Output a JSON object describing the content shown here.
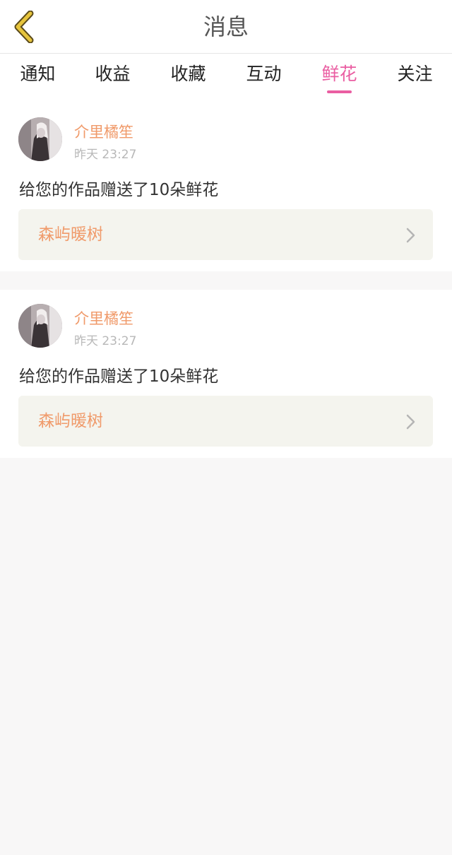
{
  "header": {
    "title": "消息",
    "back_icon": "chevron-left-icon",
    "back_icon_color": "#e6c43c"
  },
  "tabs": [
    {
      "label": "通知",
      "active": false
    },
    {
      "label": "收益",
      "active": false
    },
    {
      "label": "收藏",
      "active": false
    },
    {
      "label": "互动",
      "active": false
    },
    {
      "label": "鲜花",
      "active": true
    },
    {
      "label": "关注",
      "active": false
    }
  ],
  "accent_color": "#ea5ea2",
  "name_color": "#f09a6a",
  "messages": [
    {
      "sender": "介里橘笙",
      "time": "昨天 23:27",
      "text": "给您的作品赠送了10朵鲜花",
      "work_title": "森屿暖树",
      "link_icon": "chevron-right-icon"
    },
    {
      "sender": "介里橘笙",
      "time": "昨天 23:27",
      "text": "给您的作品赠送了10朵鲜花",
      "work_title": "森屿暖树",
      "link_icon": "chevron-right-icon"
    }
  ]
}
